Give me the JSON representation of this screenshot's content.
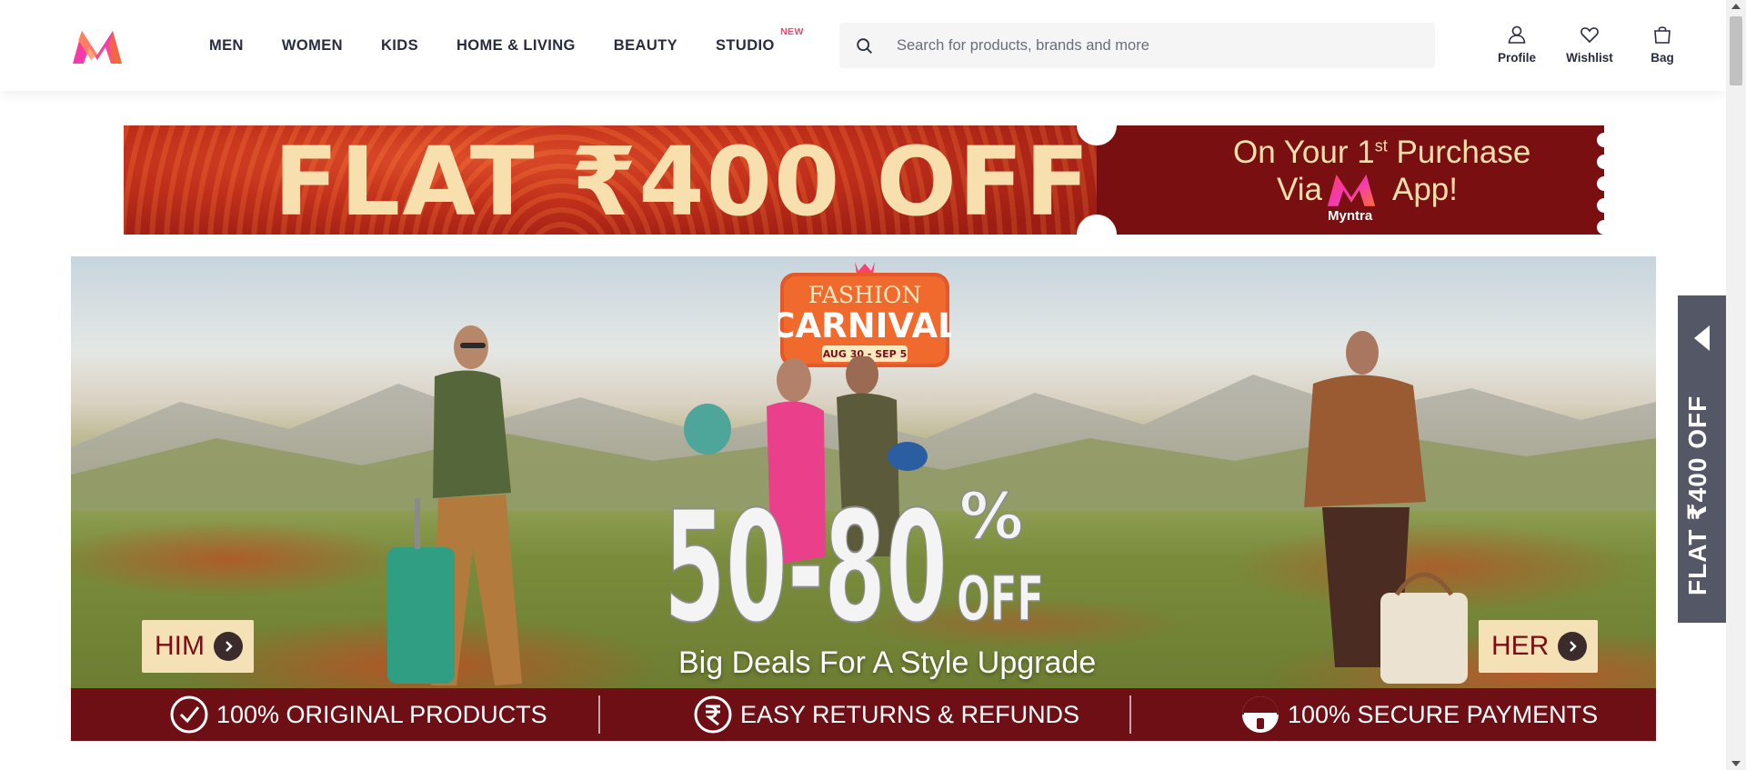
{
  "header": {
    "nav": [
      "MEN",
      "WOMEN",
      "KIDS",
      "HOME & LIVING",
      "BEAUTY",
      "STUDIO"
    ],
    "studio_badge": "NEW",
    "search": {
      "placeholder": "Search for products, brands and more",
      "value": ""
    },
    "actions": [
      {
        "label": "Profile",
        "icon": "profile-icon"
      },
      {
        "label": "Wishlist",
        "icon": "heart-icon"
      },
      {
        "label": "Bag",
        "icon": "bag-icon"
      }
    ]
  },
  "promo": {
    "headline": "FLAT ₹400 OFF",
    "line1_pre": "On Your 1",
    "line1_sup": "st",
    "line1_post": " Purchase",
    "line2_via": "Via",
    "line2_app": "App!",
    "brand": "Myntra"
  },
  "hero": {
    "event_line1": "FASHION",
    "event_line2": "CARNIVAL",
    "event_dates": "AUG 30 - SEP 5",
    "discount": "50-80",
    "discount_pct": "%",
    "discount_off": "OFF",
    "tagline": "Big Deals For A Style Upgrade",
    "him_label": "HIM",
    "her_label": "HER"
  },
  "trust": [
    {
      "label": "100% ORIGINAL PRODUCTS",
      "icon": "check-circle-icon"
    },
    {
      "label": "EASY RETURNS & REFUNDS",
      "icon": "rupee-circle-icon"
    },
    {
      "label": "100% SECURE PAYMENTS",
      "icon": "secure-icon"
    }
  ],
  "side_tab": {
    "label": "FLAT ₹400 OFF"
  },
  "colors": {
    "brand": "#ff3f6c",
    "promo_dark": "#7a0f12",
    "trust_bar": "#6e0f16",
    "cream": "#f8dfae"
  }
}
